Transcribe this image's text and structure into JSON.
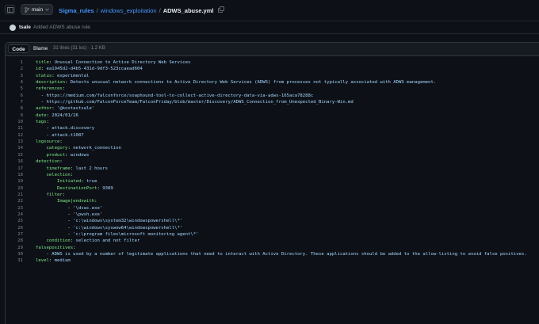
{
  "branch": {
    "name": "main"
  },
  "breadcrumb": {
    "repo": "Sigma_rules",
    "folder": "windows_exploitation",
    "file": "ADWS_abuse.yml"
  },
  "commit": {
    "author": "tsale",
    "message": "Added ADWS abuse rule"
  },
  "file": {
    "tabs": [
      "Code",
      "Blame"
    ],
    "meta": "31 lines (31 loc) · 1.2 KB"
  },
  "code": [
    {
      "ln": "1",
      "indent": "",
      "key": "title",
      "sep": ": ",
      "val": "Unusual Connection to Active Directory Web Services"
    },
    {
      "ln": "2",
      "indent": "",
      "key": "id",
      "sep": ": ",
      "val": "ea1945d2-d4b5-431d-9df3-523ccaead604"
    },
    {
      "ln": "3",
      "indent": "",
      "key": "status",
      "sep": ": ",
      "val": "experimental"
    },
    {
      "ln": "4",
      "indent": "",
      "key": "description",
      "sep": ": ",
      "val": "Detects unusual network connections to Active Directory Web Services (ADWS) from processes not typically associated with ADWS management."
    },
    {
      "ln": "5",
      "indent": "",
      "key": "references",
      "sep": ":",
      "val": ""
    },
    {
      "ln": "6",
      "indent": "  ",
      "key": "",
      "sep": "- ",
      "val": "https://medium.com/falconforce/soaphound-tool-to-collect-active-directory-data-via-adws-165aca78288c"
    },
    {
      "ln": "7",
      "indent": "  ",
      "key": "",
      "sep": "- ",
      "val": "https://github.com/FalconForceTeam/FalconFriday/blob/master/Discovery/ADWS_Connection_from_Unexpected_Binary-Win.md"
    },
    {
      "ln": "8",
      "indent": "",
      "key": "author",
      "sep": ": ",
      "val": "'@kostastsale'"
    },
    {
      "ln": "9",
      "indent": "",
      "key": "date",
      "sep": ": ",
      "val": "2024/01/26"
    },
    {
      "ln": "10",
      "indent": "",
      "key": "tags",
      "sep": ":",
      "val": ""
    },
    {
      "ln": "11",
      "indent": "    ",
      "key": "",
      "sep": "- ",
      "val": "attack.discovery"
    },
    {
      "ln": "12",
      "indent": "    ",
      "key": "",
      "sep": "- ",
      "val": "attack.t1087"
    },
    {
      "ln": "13",
      "indent": "",
      "key": "logsource",
      "sep": ":",
      "val": ""
    },
    {
      "ln": "14",
      "indent": "    ",
      "key": "category",
      "sep": ": ",
      "val": "network_connection"
    },
    {
      "ln": "15",
      "indent": "    ",
      "key": "product",
      "sep": ": ",
      "val": "windows"
    },
    {
      "ln": "16",
      "indent": "",
      "key": "detection",
      "sep": ":",
      "val": ""
    },
    {
      "ln": "17",
      "indent": "    ",
      "key": "timeframe",
      "sep": ": ",
      "val": "last 2 hours"
    },
    {
      "ln": "18",
      "indent": "    ",
      "key": "selection",
      "sep": ":",
      "val": ""
    },
    {
      "ln": "19",
      "indent": "        ",
      "key": "Initiated",
      "sep": ": ",
      "val": "true"
    },
    {
      "ln": "20",
      "indent": "        ",
      "key": "DestinationPort",
      "sep": ": ",
      "val": "9389"
    },
    {
      "ln": "21",
      "indent": "    ",
      "key": "filter",
      "sep": ":",
      "val": ""
    },
    {
      "ln": "22",
      "indent": "        ",
      "key": "Image|endswith",
      "sep": ":",
      "val": ""
    },
    {
      "ln": "23",
      "indent": "            ",
      "key": "",
      "sep": "- ",
      "val": "'\\dsac.exe'"
    },
    {
      "ln": "24",
      "indent": "            ",
      "key": "",
      "sep": "- ",
      "val": "'\\pwsh.exe'"
    },
    {
      "ln": "25",
      "indent": "            ",
      "key": "",
      "sep": "- ",
      "val": "'c:\\windows\\system32\\windowspowershell\\*'"
    },
    {
      "ln": "26",
      "indent": "            ",
      "key": "",
      "sep": "- ",
      "val": "'c:\\windows\\syswow64\\windowspowershell\\*'"
    },
    {
      "ln": "27",
      "indent": "            ",
      "key": "",
      "sep": "- ",
      "val": "'c:\\program files\\microsoft monitoring agent\\*'"
    },
    {
      "ln": "28",
      "indent": "    ",
      "key": "condition",
      "sep": ": ",
      "val": "selection and not filter"
    },
    {
      "ln": "29",
      "indent": "",
      "key": "falsepositives",
      "sep": ":",
      "val": ""
    },
    {
      "ln": "30",
      "indent": "    ",
      "key": "",
      "sep": "- ",
      "val": "ADWS is used by a number of legitimate applications that need to interact with Active Directory. These applications should be added to the allow-listing to avoid false positives."
    },
    {
      "ln": "31",
      "indent": "",
      "key": "level",
      "sep": ": ",
      "val": "medium"
    }
  ]
}
